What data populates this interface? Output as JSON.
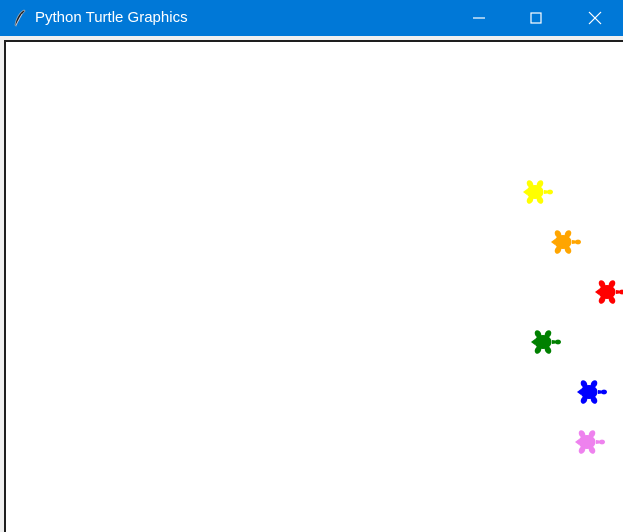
{
  "window": {
    "title": "Python Turtle Graphics",
    "icon": "feather-icon",
    "buttons": [
      "minimize-icon",
      "maximize-icon",
      "close-icon"
    ]
  },
  "canvas": {
    "background": "#ffffff",
    "turtles": [
      {
        "color": "#ffff00",
        "heading": "east"
      },
      {
        "color": "#ffa500",
        "heading": "east"
      },
      {
        "color": "#ff0000",
        "heading": "east"
      },
      {
        "color": "#008000",
        "heading": "east"
      },
      {
        "color": "#0000ff",
        "heading": "east"
      },
      {
        "color": "#ee82ee",
        "heading": "east"
      }
    ]
  }
}
